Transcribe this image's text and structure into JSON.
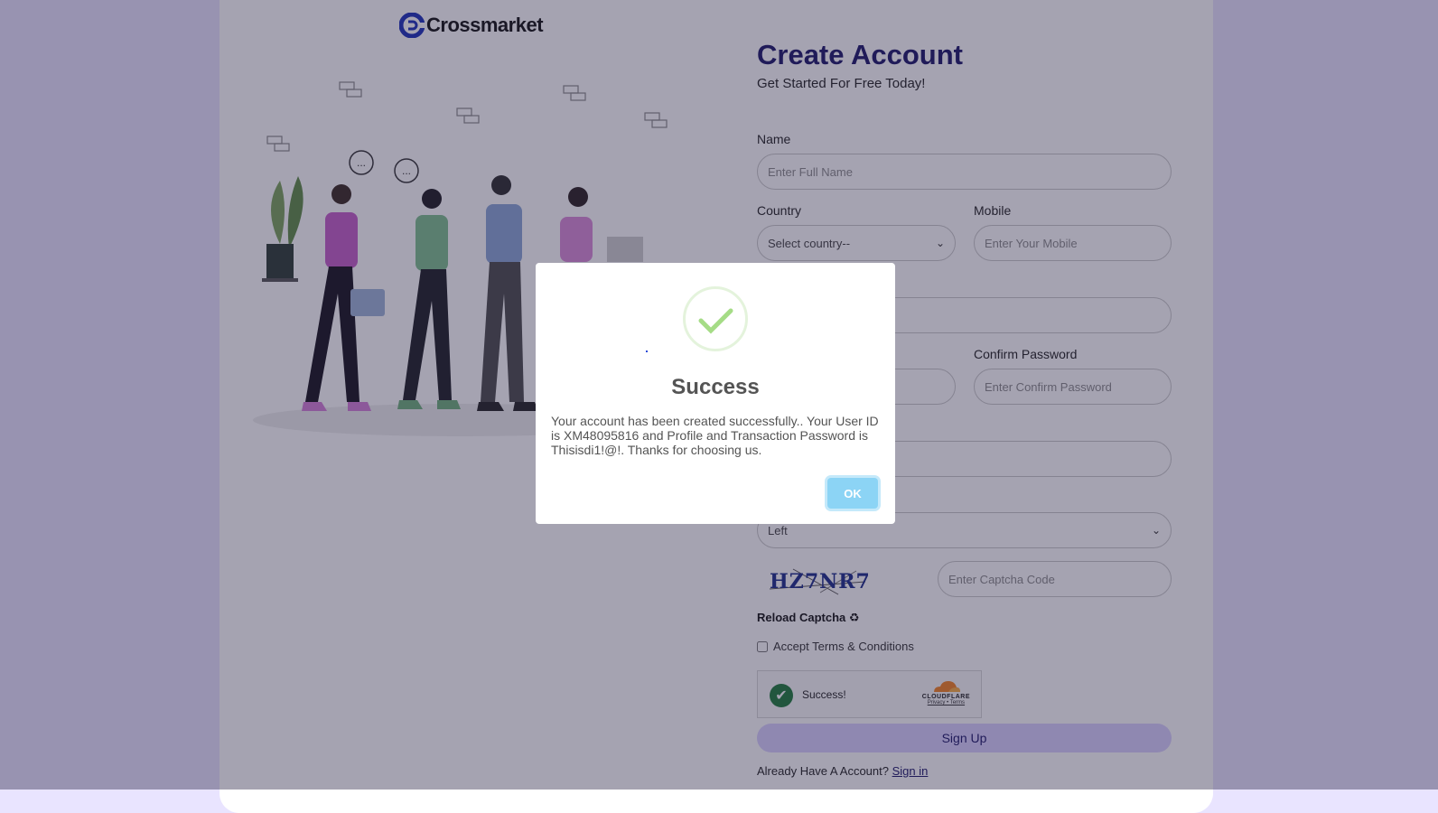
{
  "brand": {
    "name": "Crossmarket"
  },
  "form": {
    "title": "Create Account",
    "subtitle": "Get Started For Free Today!",
    "name_label": "Name",
    "name_placeholder": "Enter Full Name",
    "country_label": "Country",
    "country_value": "Select country--",
    "mobile_label": "Mobile",
    "mobile_placeholder": "Enter Your Mobile",
    "confirm_password_label": "Confirm Password",
    "confirm_password_placeholder": "Enter Confirm Password",
    "position_value": "Left",
    "captcha_text": "HZ7NR7",
    "captcha_placeholder": "Enter Captcha Code",
    "reload_label": "Reload Captcha",
    "reload_icon": "recycle-icon",
    "terms_label": "Accept Terms & Conditions",
    "terms_checked": false,
    "cloudflare": {
      "status": "Success!",
      "brand": "CLOUDFLARE",
      "links": "Privacy • Terms"
    },
    "signup_label": "Sign Up",
    "already_text": "Already Have A Account?",
    "signin_label": "Sign in"
  },
  "modal": {
    "icon": "success-check-icon",
    "title": "Success",
    "message": "Your account has been created successfully.. Your User ID is XM48095816 and Profile and Transaction Password is Thisisdi1!@!. Thanks for choosing us.",
    "ok_label": "OK"
  },
  "colors": {
    "background": "#e9e4ff",
    "title": "#1a1568",
    "signup_button": "#d9d0ff",
    "ok_button": "#8cd4f5",
    "success_check": "#a5dc86"
  }
}
